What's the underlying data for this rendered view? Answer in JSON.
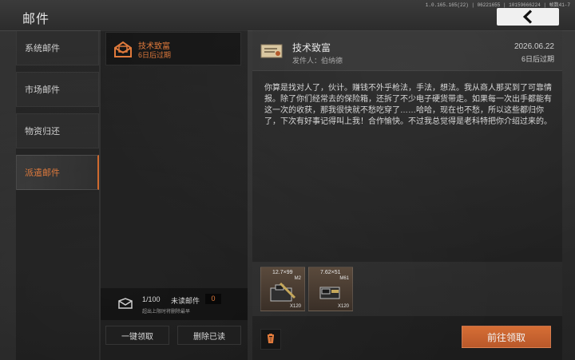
{
  "app": {
    "title": "邮件",
    "version_text": "1.0.165.165(22) | 06221655 | 10159666224 | 帧数41-7",
    "back_icon": "chevron-left-icon"
  },
  "left_nav": {
    "items": [
      {
        "label": "系统邮件",
        "active": false
      },
      {
        "label": "市场邮件",
        "active": false
      },
      {
        "label": "物资归还",
        "active": false
      },
      {
        "label": "派遣邮件",
        "active": true
      }
    ]
  },
  "mail_list": {
    "items": [
      {
        "subject": "技术致富",
        "expire": "6日后过期",
        "icon": "open-envelope-icon"
      }
    ],
    "count_text": "1/100",
    "unread_label": "未读邮件",
    "unread_count": "0",
    "limit_hint": "超出上限时将删除最早",
    "buttons": {
      "claim_all": "一键领取",
      "delete_read": "删除已读"
    }
  },
  "detail": {
    "subject": "技术致富",
    "sender_label": "发件人：伯纳德",
    "date": "2026.06.22",
    "expire": "6日后过期",
    "body": "你算是找对人了，伙计。赚钱不外乎枪法，手法，想法。我从商人那买到了可靠情报。除了你们经常去的保险箱，还拆了不少电子硬货带走。如果每一次出手都能有这一次的收获，那我很快就不愁吃穿了……哈哈，现在也不愁，所以这些都归你了，下次有好事记得叫上我！合作愉快。不过我总觉得是老科特把你介绍过来的。",
    "attachments": [
      {
        "caliber": "12.7×99",
        "name": "M2",
        "qty": "X120"
      },
      {
        "caliber": "7.62×51",
        "name": "M61",
        "qty": "X120"
      }
    ],
    "claim_button": "前往领取",
    "trash_icon": "trash-icon"
  },
  "colors": {
    "accent": "#d66e35",
    "accent_text": "#e07a3c"
  }
}
